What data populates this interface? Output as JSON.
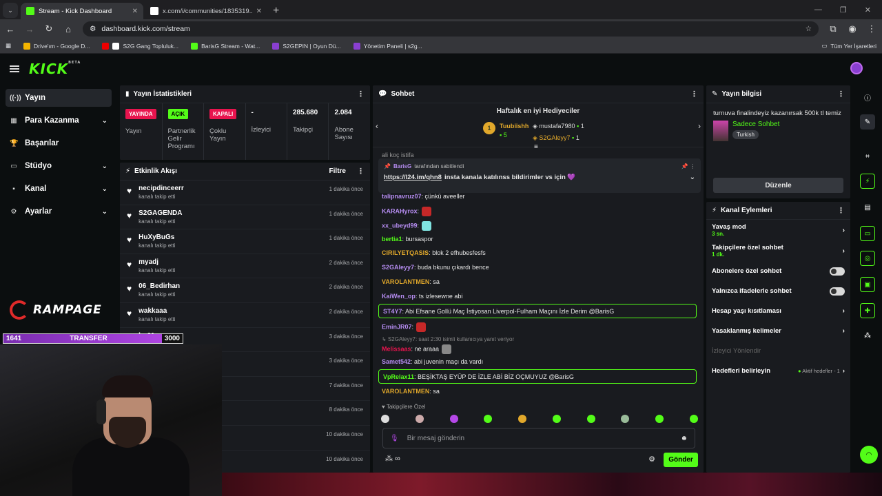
{
  "browser": {
    "tabs": [
      {
        "title": "Stream - Kick Dashboard",
        "active": true
      },
      {
        "title": "x.com/i/communities/1835319...",
        "active": false
      }
    ],
    "url": "dashboard.kick.com/stream",
    "bookmarks": [
      "Drive'ım - Google D...",
      "S2G Gang Topluluk...",
      "BarisG Stream - Wat...",
      "S2GEPIN | Oyun Dü...",
      "Yönetim Paneli | s2g..."
    ],
    "bookmarks_right": "Tüm Yer İşaretleri"
  },
  "header": {
    "logo": "KICK",
    "logo_sup": "BETA"
  },
  "sidebar": {
    "items": [
      {
        "label": "Yayın",
        "icon": "((·))",
        "chev": ""
      },
      {
        "label": "Para Kazanma",
        "icon": "▦",
        "chev": "⌄"
      },
      {
        "label": "Başarılar",
        "icon": "🏆",
        "chev": ""
      },
      {
        "label": "Stüdyo",
        "icon": "▭",
        "chev": "⌄"
      },
      {
        "label": "Kanal",
        "icon": "▪",
        "chev": "⌄"
      },
      {
        "label": "Ayarlar",
        "icon": "⚙",
        "chev": "⌄"
      }
    ]
  },
  "stats": {
    "title": "Yayın İstatistikleri",
    "items": [
      {
        "badge": "YAYINDA",
        "badge_color": "#e8144e",
        "label": "Yayın"
      },
      {
        "badge": "AÇIK",
        "badge_color": "#53fc18",
        "label": "Partnerlik Gelir Programı"
      },
      {
        "badge": "KAPALI",
        "badge_color": "#e8144e",
        "label": "Çoklu Yayın"
      },
      {
        "value": "-",
        "label": "İzleyici"
      },
      {
        "value": "285.680",
        "label": "Takipçi"
      },
      {
        "value": "2.084",
        "label": "Abone Sayısı"
      }
    ]
  },
  "feed": {
    "title": "Etkinlik Akışı",
    "filter": "Filtre",
    "items": [
      {
        "name": "necipdinceerr",
        "sub": "kanalı takip etti",
        "time": "1 dakika önce"
      },
      {
        "name": "S2GAGENDA",
        "sub": "kanalı takip etti",
        "time": "1 dakika önce"
      },
      {
        "name": "HuXyBuGs",
        "sub": "kanalı takip etti",
        "time": "1 dakika önce"
      },
      {
        "name": "myadj",
        "sub": "kanalı takip etti",
        "time": "2 dakika önce"
      },
      {
        "name": "06_Bedirhan",
        "sub": "kanalı takip etti",
        "time": "2 dakika önce"
      },
      {
        "name": "wakkaaa",
        "sub": "kanalı takip etti",
        "time": "2 dakika önce"
      },
      {
        "name": "bg61",
        "sub": "",
        "time": "3 dakika önce"
      },
      {
        "name": "",
        "sub": "",
        "time": "3 dakika önce"
      },
      {
        "name": "",
        "sub": "",
        "time": "7 dakika önce"
      },
      {
        "name": "",
        "sub": "",
        "time": "8 dakika önce"
      },
      {
        "name": "",
        "sub": "",
        "time": "10 dakika önce"
      },
      {
        "name": "",
        "sub": "",
        "time": "10 dakika önce"
      }
    ]
  },
  "chat": {
    "title": "Sohbet",
    "gifters_title": "Haftalık en iyi Hediyeciler",
    "top1": {
      "name": "Tuubiishh",
      "count": "5"
    },
    "top2": {
      "name": "mustafa7980",
      "count": "1"
    },
    "top3": {
      "name": "S2GAleyy7",
      "count": "1"
    },
    "partial": "ali koç istifa",
    "pinned": {
      "by": "BarisG",
      "by_suffix": "tarafından sabitlendi",
      "link": "https://l24.im/qhn8",
      "text": "insta kanala katılınss bildirimler vs için 💜"
    },
    "messages": [
      {
        "user": "talipnavruz07",
        "color": "#b58cf0",
        "text": ": çünkü aveeller"
      },
      {
        "user": "KARAHyrox",
        "color": "#b58cf0",
        "text": ":"
      },
      {
        "user": "xx_ubeyd99",
        "color": "#b58cf0",
        "text": ":"
      },
      {
        "user": "bertia1",
        "color": "#53fc18",
        "text": ": bursaspor"
      },
      {
        "user": "CIRILYETQASIS",
        "color": "#e1a82b",
        "text": ": blok 2 efhubesfesfs"
      },
      {
        "user": "S2GAleyy7",
        "color": "#b58cf0",
        "text": ": buda bkunu çıkardı bence"
      },
      {
        "user": "VAROLANTMEN",
        "color": "#e1a82b",
        "text": ": sa"
      },
      {
        "user": "KaiWen_op",
        "color": "#b58cf0",
        "text": ": ts izlesewne abi"
      }
    ],
    "hl1": {
      "user": "ST4Y7",
      "text": ": Abi Efsane Gollü Maç İstiyosan Liverpol-Fulham Maçını İzle Derim @BarisG"
    },
    "m2": [
      {
        "user": "EminJR07",
        "color": "#b58cf0",
        "text": ":"
      }
    ],
    "reply": "S2GAleyy7: saat 2:30 isimli kullanıcıya yanıt veriyor",
    "m3": [
      {
        "user": "Melissaas",
        "color": "#e8144e",
        "text": ": ne araaa"
      },
      {
        "user": "Samet542",
        "color": "#b58cf0",
        "text": ": abi juvenin maçı da vardı"
      }
    ],
    "hl2": {
      "user": "VpRelax11",
      "text": ": BEŞİKTAŞ EYÜP DE İZLE ABİ BİZ OÇMUYUZ @BarisG"
    },
    "m4": [
      {
        "user": "VAROLANTMEN",
        "color": "#e1a82b",
        "text": ": sa"
      }
    ],
    "follower_only": "Takipçilere Özel",
    "input_placeholder": "Bir mesaj gönderin",
    "send": "Gönder"
  },
  "info": {
    "title": "Yayın bilgisi",
    "stream_title": "turnuva finalindeyiz kazanırsak 500k tl temiz",
    "category": "Sadece Sohbet",
    "language": "Turkish",
    "edit": "Düzenle"
  },
  "actions": {
    "title": "Kanal Eylemleri",
    "slow": {
      "label": "Yavaş mod",
      "sub": "3 sn."
    },
    "follower": {
      "label": "Takipçilere özel sohbet",
      "sub": "1 dk."
    },
    "sub_only": "Abonelere özel sohbet",
    "emote_only": "Yalnızca ifadelerle sohbet",
    "age": "Hesap yaşı kısıtlaması",
    "banned": "Yasaklanmış kelimeler",
    "redirect": "İzleyici Yönlendir",
    "goals": "Hedefleri belirleyin",
    "goals_status": "Aktif hedefler - 1"
  },
  "overlay": {
    "brand": "RAMPAGE",
    "transfer_left": "1641",
    "transfer_label": "TRANSFER",
    "transfer_right": "3000"
  },
  "colors": {
    "accent": "#53fc18",
    "panel": "#191b1f"
  }
}
